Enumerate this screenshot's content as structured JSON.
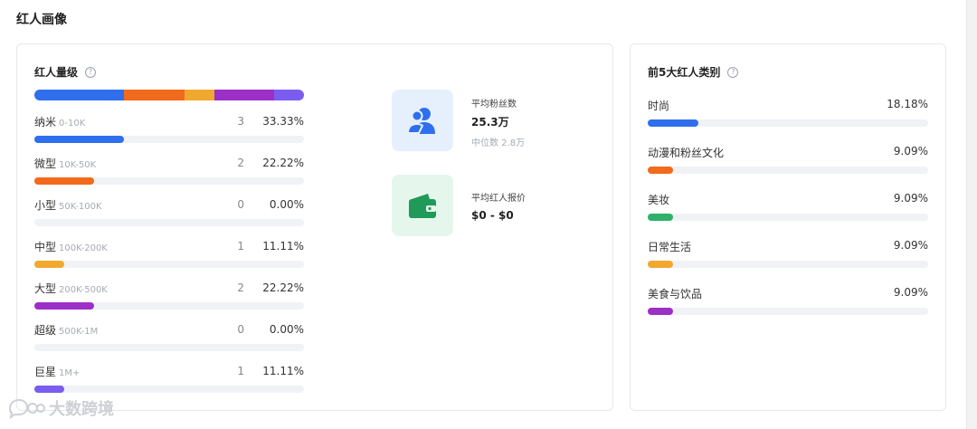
{
  "page": {
    "title": "红人画像"
  },
  "tiers_card": {
    "title": "红人量级",
    "help": "?",
    "stack_segments": [
      {
        "color": "#2f6fed",
        "fraction": 0.3333
      },
      {
        "color": "#f26a1b",
        "fraction": 0.2222
      },
      {
        "color": "#f0a92e",
        "fraction": 0.1111
      },
      {
        "color": "#9b2fc6",
        "fraction": 0.2222
      },
      {
        "color": "#7b5cf0",
        "fraction": 0.1111
      }
    ],
    "tiers": [
      {
        "name": "纳米",
        "range": "0-10K",
        "count": "3",
        "percent": "33.33%",
        "fraction": 0.3333,
        "color": "#2f6fed"
      },
      {
        "name": "微型",
        "range": "10K-50K",
        "count": "2",
        "percent": "22.22%",
        "fraction": 0.2222,
        "color": "#f26a1b"
      },
      {
        "name": "小型",
        "range": "50K-100K",
        "count": "0",
        "percent": "0.00%",
        "fraction": 0.0,
        "color": "#2fb06a"
      },
      {
        "name": "中型",
        "range": "100K-200K",
        "count": "1",
        "percent": "11.11%",
        "fraction": 0.1111,
        "color": "#f0a92e"
      },
      {
        "name": "大型",
        "range": "200K-500K",
        "count": "2",
        "percent": "22.22%",
        "fraction": 0.2222,
        "color": "#9b2fc6"
      },
      {
        "name": "超级",
        "range": "500K-1M",
        "count": "0",
        "percent": "0.00%",
        "fraction": 0.0,
        "color": "#e84a8a"
      },
      {
        "name": "巨星",
        "range": "1M+",
        "count": "1",
        "percent": "11.11%",
        "fraction": 0.1111,
        "color": "#7b5cf0"
      }
    ],
    "stats": {
      "followers": {
        "icon": "users-icon",
        "label": "平均粉丝数",
        "value": "25.3万",
        "median": "中位数 2.8万",
        "bg": "#e6f0fd",
        "color": "#2f6fed"
      },
      "price": {
        "icon": "wallet-icon",
        "label": "平均红人报价",
        "value": "$0 - $0",
        "bg": "#e5f7ec",
        "color": "#1f9a58"
      }
    }
  },
  "categories_card": {
    "title": "前5大红人类别",
    "help": "?",
    "categories": [
      {
        "name": "时尚",
        "percent": "18.18%",
        "fraction": 0.1818,
        "color": "#2f6fed"
      },
      {
        "name": "动漫和粉丝文化",
        "percent": "9.09%",
        "fraction": 0.0909,
        "color": "#f26a1b"
      },
      {
        "name": "美妆",
        "percent": "9.09%",
        "fraction": 0.0909,
        "color": "#2fb06a"
      },
      {
        "name": "日常生活",
        "percent": "9.09%",
        "fraction": 0.0909,
        "color": "#f0a92e"
      },
      {
        "name": "美食与饮品",
        "percent": "9.09%",
        "fraction": 0.0909,
        "color": "#9b2fc6"
      }
    ]
  },
  "watermark": {
    "text": "大数跨境",
    "icon": "chat-bubble-icon"
  }
}
